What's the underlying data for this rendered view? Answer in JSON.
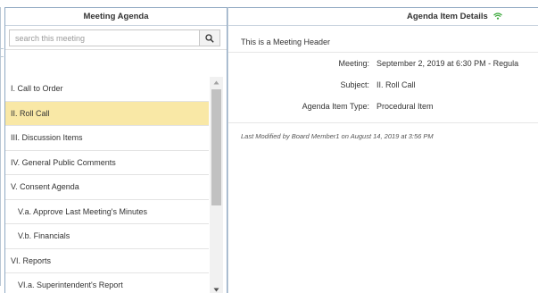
{
  "left_panel": {
    "title": "Meeting Agenda",
    "search": {
      "placeholder": "search this meeting",
      "value": ""
    },
    "items": [
      {
        "label": "I. Call to Order",
        "level": 0,
        "selected": false
      },
      {
        "label": "II. Roll Call",
        "level": 0,
        "selected": true
      },
      {
        "label": "III. Discussion Items",
        "level": 0,
        "selected": false
      },
      {
        "label": "IV. General Public Comments",
        "level": 0,
        "selected": false
      },
      {
        "label": "V. Consent Agenda",
        "level": 0,
        "selected": false
      },
      {
        "label": "V.a. Approve Last Meeting's Minutes",
        "level": 1,
        "selected": false
      },
      {
        "label": "V.b. Financials",
        "level": 1,
        "selected": false
      },
      {
        "label": "VI. Reports",
        "level": 0,
        "selected": false
      },
      {
        "label": "VI.a. Superintendent's Report",
        "level": 1,
        "selected": false
      }
    ]
  },
  "right_panel": {
    "title": "Agenda Item Details",
    "meeting_header": "This is a Meeting Header",
    "details": {
      "meeting_label": "Meeting:",
      "meeting_value": "September 2, 2019 at 6:30 PM - Regula",
      "subject_label": "Subject:",
      "subject_value": "II. Roll Call",
      "type_label": "Agenda Item Type:",
      "type_value": "Procedural Item"
    },
    "last_modified": "Last Modified by Board Member1 on August 14, 2019 at 3:56 PM"
  },
  "icons": {
    "search": "search-icon",
    "wifi": "wifi-icon",
    "scroll_up": "chevron-up-icon",
    "scroll_down": "chevron-down-icon"
  },
  "colors": {
    "selected_row": "#f9e8a6",
    "panel_border": "#8fa8c2",
    "wifi_green": "#3aa83a"
  }
}
